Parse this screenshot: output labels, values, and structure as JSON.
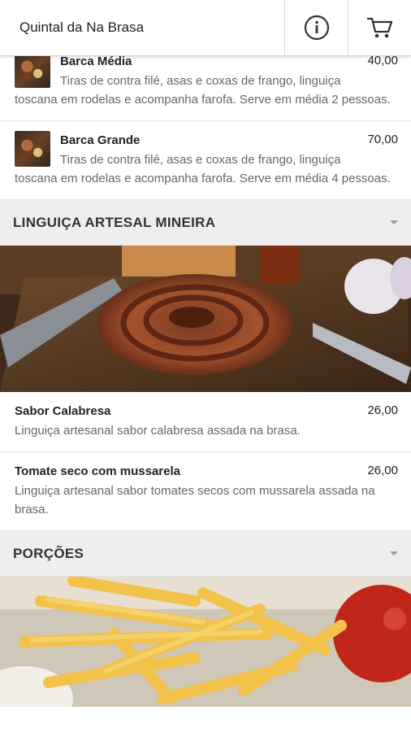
{
  "header": {
    "title": "Quintal da Na Brasa",
    "info_icon": "info-icon",
    "cart_icon": "cart-icon"
  },
  "sections": [
    {
      "items": [
        {
          "name": "Barca Média",
          "price": "40,00",
          "desc_first": "Tiras de contra filé, asas e coxas de frango, linguiça",
          "desc_rest": "toscana em rodelas e acompanha farofa. Serve em média 2 pessoas."
        },
        {
          "name": "Barca Grande",
          "price": "70,00",
          "desc_first": "Tiras de contra filé, asas e coxas de frango, linguiça",
          "desc_rest": "toscana em rodelas e acompanha farofa. Serve em média 4 pessoas."
        }
      ]
    },
    {
      "title": "LINGUIÇA ARTESAL MINEIRA",
      "items": [
        {
          "name": "Sabor Calabresa",
          "price": "26,00",
          "desc": "Linguiça artesanal sabor calabresa assada na brasa."
        },
        {
          "name": "Tomate seco com mussarela",
          "price": "26,00",
          "desc": "Linguiça artesanal sabor tomates secos com mussarela assada na brasa."
        }
      ]
    },
    {
      "title": "PORÇÕES"
    }
  ],
  "colors": {
    "section_bg": "#eeeeee",
    "price_text": "#222222",
    "desc_text": "#666666"
  }
}
